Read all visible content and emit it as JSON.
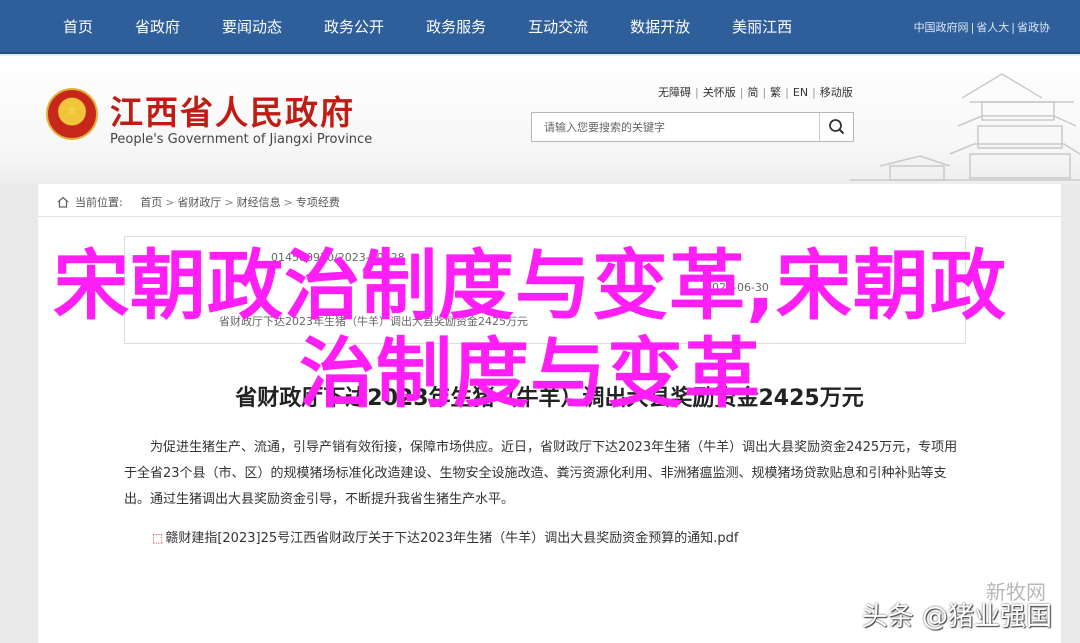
{
  "topnav": {
    "menu": [
      "首页",
      "省政府",
      "要闻动态",
      "政务公开",
      "政务服务",
      "互动交流",
      "数据开放",
      "美丽江西"
    ],
    "links": [
      "中国政府网",
      "省人大",
      "省政协"
    ]
  },
  "header": {
    "title": "江西省人民政府",
    "subtitle": "People's Government of Jiangxi Province",
    "tools": [
      "无障碍",
      "关怀版",
      "简",
      "繁",
      "EN",
      "移动版"
    ],
    "search_placeholder": "请输入您要搜索的关键字"
  },
  "breadcrumb": {
    "label": "当前位置:",
    "items": [
      "首页",
      "省财政厅",
      "财经信息",
      "专项经费"
    ]
  },
  "info": {
    "index_no": "014500970/2023-00228",
    "date": "2023-06-30",
    "title_short": "省财政厅下达2023年生猪（牛羊）调出大县奖励资金2425万元"
  },
  "article": {
    "title": "省财政厅下达2023年生猪（牛羊）调出大县奖励资金2425万元",
    "paragraph": "为促进生猪生产、流通，引导产销有效衔接，保障市场供应。近日，省财政厅下达2023年生猪（牛羊）调出大县奖励资金2425万元，专项用于全省23个县（市、区）的规模猪场标准化改造建设、生物安全设施改造、粪污资源化利用、非洲猪瘟监测、规模猪场贷款贴息和引种补贴等支出。通过生猪调出大县奖励资金引导，不断提升我省生猪生产水平。",
    "attachment": "赣财建指[2023]25号江西省财政厅关于下达2023年生猪（牛羊）调出大县奖励资金预算的通知.pdf"
  },
  "overlay": {
    "title": "宋朝政治制度与变革,宋朝政治制度与变革"
  },
  "watermark": {
    "top": "新牧网",
    "main": "头条 @猪业强国"
  },
  "colors": {
    "nav_bg": "#2e5f9b",
    "brand_red": "#bf1d14",
    "overlay_magenta": "#ff1ef6"
  }
}
